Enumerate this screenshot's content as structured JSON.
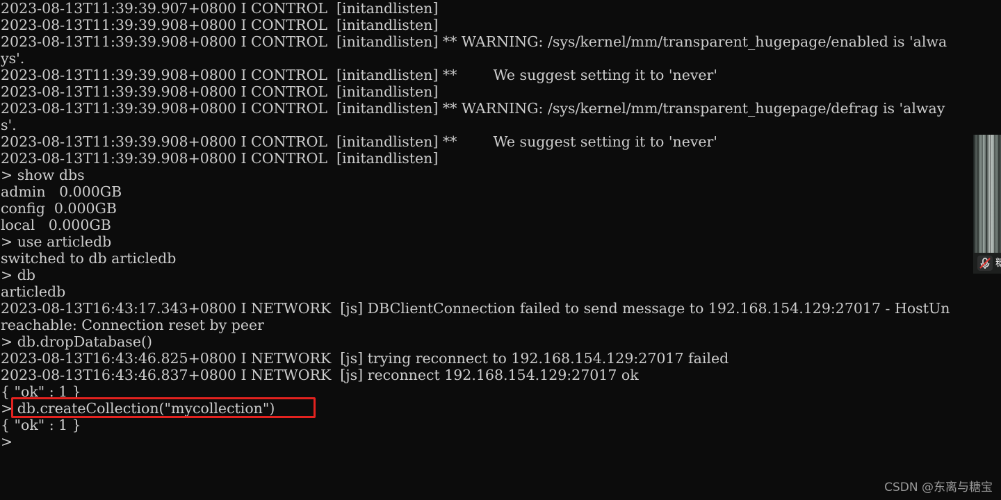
{
  "terminal": {
    "lines": [
      "2023-08-13T11:39:39.907+0800 I CONTROL  [initandlisten]",
      "2023-08-13T11:39:39.908+0800 I CONTROL  [initandlisten]",
      "2023-08-13T11:39:39.908+0800 I CONTROL  [initandlisten] ** WARNING: /sys/kernel/mm/transparent_hugepage/enabled is 'alwa",
      "ys'.",
      "2023-08-13T11:39:39.908+0800 I CONTROL  [initandlisten] **        We suggest setting it to 'never'",
      "2023-08-13T11:39:39.908+0800 I CONTROL  [initandlisten]",
      "2023-08-13T11:39:39.908+0800 I CONTROL  [initandlisten] ** WARNING: /sys/kernel/mm/transparent_hugepage/defrag is 'alway",
      "s'.",
      "2023-08-13T11:39:39.908+0800 I CONTROL  [initandlisten] **        We suggest setting it to 'never'",
      "2023-08-13T11:39:39.908+0800 I CONTROL  [initandlisten]",
      "> show dbs",
      "admin   0.000GB",
      "config  0.000GB",
      "local   0.000GB",
      "> use articledb",
      "switched to db articledb",
      "> db",
      "articledb",
      "2023-08-13T16:43:17.343+0800 I NETWORK  [js] DBClientConnection failed to send message to 192.168.154.129:27017 - HostUn",
      "reachable: Connection reset by peer",
      "> db.dropDatabase()",
      "2023-08-13T16:43:46.825+0800 I NETWORK  [js] trying reconnect to 192.168.154.129:27017 failed",
      "2023-08-13T16:43:46.837+0800 I NETWORK  [js] reconnect 192.168.154.129:27017 ok",
      "{ \"ok\" : 1 }",
      "> db.createCollection(\"mycollection\")",
      "{ \"ok\" : 1 }",
      ">"
    ],
    "highlighted_line_index": 24
  },
  "colors": {
    "background": "#0c0c0c",
    "text": "#cccccc",
    "highlight_border": "#e3221f"
  },
  "thumbnail": {
    "label_char": "糖",
    "icon": "mic-off-icon"
  },
  "watermark": {
    "text": "CSDN @东离与糖宝"
  }
}
